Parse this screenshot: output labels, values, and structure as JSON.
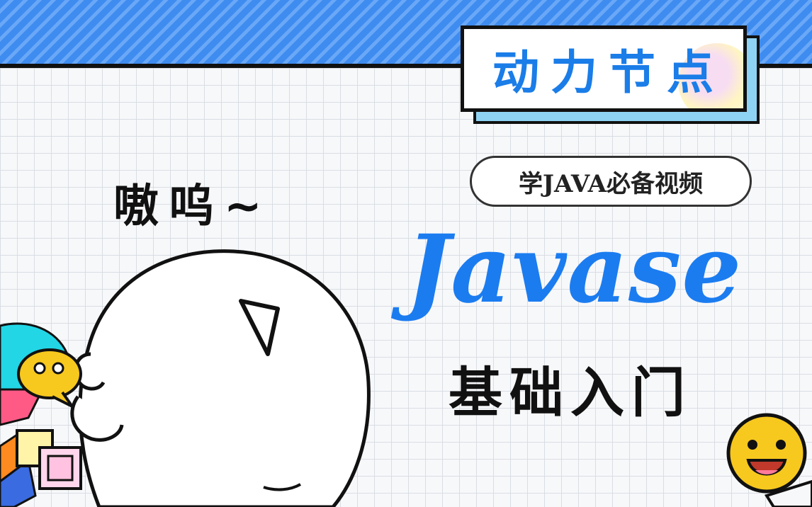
{
  "brand": {
    "name": "动力节点"
  },
  "tagline": "学JAVA必备视频",
  "title": "Javase",
  "subtitle": "基础入门",
  "speech": "嗷呜~",
  "colors": {
    "accent_blue": "#1b7cf0",
    "stripe_blue": "#3f8cf0",
    "shadow_cyan": "#8fd3f4",
    "emoji_yellow": "#f7c81e",
    "outline": "#111111"
  },
  "icons": [
    "chat-bubble-emoji-icon",
    "smiley-face-icon",
    "window-squares-icon",
    "cartoon-mascot-icon"
  ]
}
